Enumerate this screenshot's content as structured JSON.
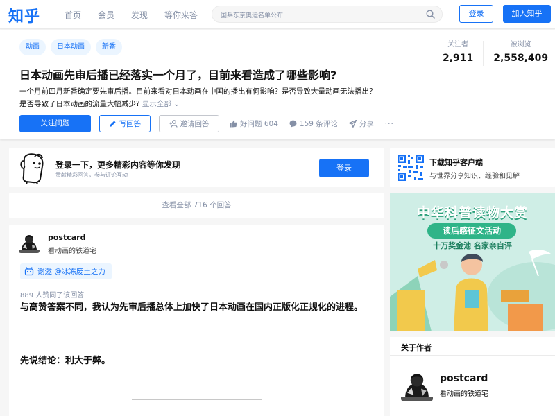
{
  "header": {
    "logo": "知乎",
    "nav": [
      "首页",
      "会员",
      "发现",
      "等你来答"
    ],
    "search_placeholder": "国乒东京奥运名单公布",
    "login_label": "登录",
    "join_label": "加入知乎"
  },
  "question": {
    "topics": [
      "动画",
      "日本动画",
      "新番"
    ],
    "followers_label": "关注者",
    "followers": "2,911",
    "views_label": "被浏览",
    "views": "2,558,409",
    "title": "日本动画先审后播已经落实一个月了，目前来看造成了哪些影响?",
    "detail": "一个月前四月新番确定要先审后播。目前来看对日本动画在中国的播出有何影响？是否导致大量动画无法播出？是否导致了日本动画的流量大幅减少?",
    "show_all": "显示全部",
    "follow_btn": "关注问题",
    "write_btn": "写回答",
    "invite_btn": "邀请回答",
    "good_question": "好问题 604",
    "comments": "159 条评论",
    "share": "分享",
    "more": "···"
  },
  "login_prompt": {
    "title": "登录一下，更多精彩内容等你发现",
    "subtitle": "贡献精彩回答，参与评论互动",
    "button": "登录"
  },
  "view_all_answers": "查看全部 716 个回答",
  "answer": {
    "author": "postcard",
    "bio": "看动画的铁道宅",
    "invite_text": "谢邀 @冰冻废土之力",
    "votes": "889 人赞同了该回答",
    "para1": "与高赞答案不同，我认为先审后播总体上加快了日本动画在国内正版化正规化的进程。",
    "para2": "先说结论：利大于弊。"
  },
  "app_card": {
    "title": "下载知乎客户端",
    "subtitle": "与世界分享知识、经验和见解"
  },
  "banner": {
    "title": "中华科普读物大赏",
    "subtitle": "读后感征文活动",
    "tagline": "十万奖金池 名家亲自评"
  },
  "about_author": {
    "heading": "关于作者",
    "name": "postcard",
    "bio": "看动画的铁道宅"
  },
  "colors": {
    "brand": "#1772f6",
    "banner_bg": "#cfeee6"
  }
}
